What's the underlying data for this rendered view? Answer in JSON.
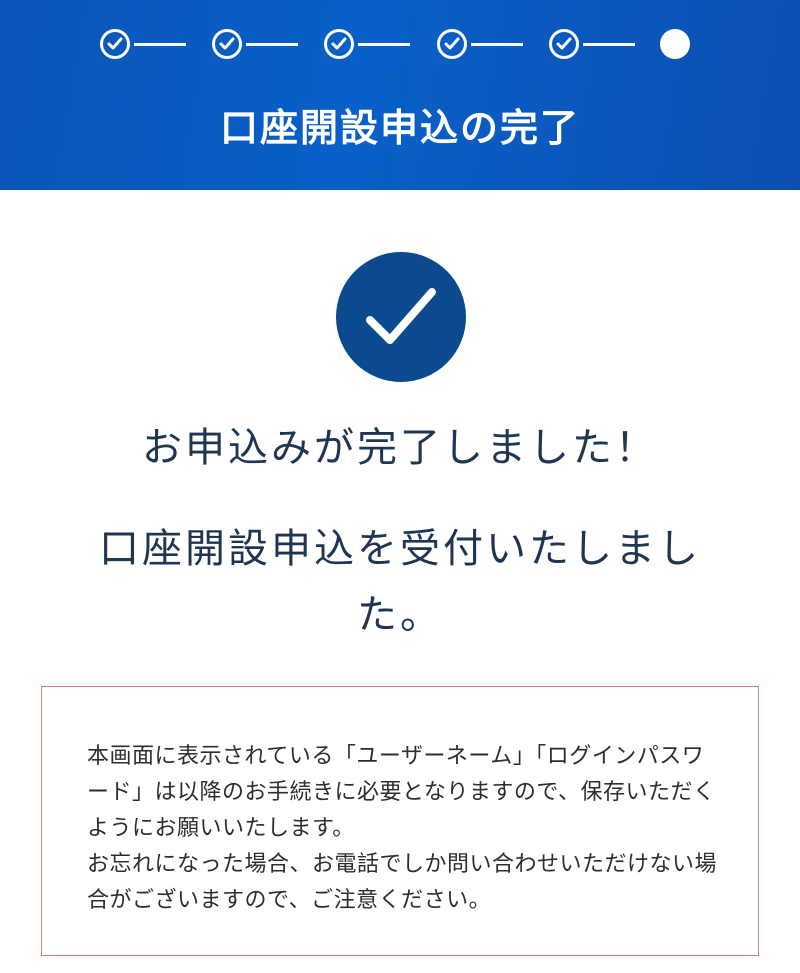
{
  "header": {
    "title": "口座開設申込の完了",
    "steps": [
      {
        "state": "done",
        "icon": "check-icon"
      },
      {
        "state": "done",
        "icon": "check-icon"
      },
      {
        "state": "done",
        "icon": "check-icon"
      },
      {
        "state": "done",
        "icon": "check-icon"
      },
      {
        "state": "done",
        "icon": "check-icon"
      },
      {
        "state": "current",
        "icon": "dot"
      }
    ],
    "background_color": "#0a55b8"
  },
  "success": {
    "icon": "checkmark-circle-icon",
    "icon_color": "#0b4a8e",
    "title": "お申込みが完了しました！",
    "message": "口座開設申込を受付いたしました。"
  },
  "notice": {
    "border_color": "#e07a7a",
    "text": "本画面に表示されている「ユーザーネーム」「ログインパスワード」は以降のお手続きに必要となりますので、保存いただくようにお願いいたします。\nお忘れになった場合、お電話でしか問い合わせいただけない場合がございますので、ご注意ください。"
  }
}
